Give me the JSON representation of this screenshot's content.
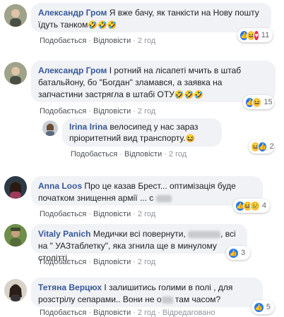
{
  "comments": [
    {
      "author": "Александр Гром",
      "text": "Я вже бачу, як танкісти на Нову пошту їдуть танком",
      "emoji": "🤣🤣🤣",
      "actions": {
        "like": "Подобається",
        "reply": "Відповісти",
        "time": "2 год"
      },
      "reactions": {
        "count": "11"
      }
    },
    {
      "author": "Александр Гром",
      "text": "І ротний на лісапеті мчить в штаб батальйону, бо \"Богдан\" зламався, а заявка на запчастини застрягла в штабі ОТУ",
      "emoji": "🤣🤣🤣",
      "actions": {
        "like": "Подобається",
        "reply": "Відповісти",
        "time": "2 год"
      },
      "reactions": {
        "count": "15"
      }
    },
    {
      "author": "Irina Irina",
      "text": "велосипед у нас зараз пріоритетний вид транспорту.",
      "emoji": "😆",
      "actions": {
        "like": "Подобається",
        "reply": "Відповісти",
        "time": "2 год"
      },
      "reactions": {
        "count": "2"
      }
    },
    {
      "author": "Anna Loos",
      "text": "Про це казав Брест... оптимізація буде початком знищення армії ... с",
      "actions": {
        "like": "Подобається",
        "reply": "Відповісти",
        "time": "2 год"
      },
      "reactions": {
        "count": "4"
      }
    },
    {
      "author": "Vitaly Panich",
      "text_a": "Медички всі повернути,",
      "text_b": ", всі на \" УАЗтаблетку\", яка згнила ще в минулому столітті.",
      "actions": {
        "like": "Подобається",
        "reply": "Відповісти",
        "time": "2 год"
      },
      "reactions": {
        "count": "3"
      }
    },
    {
      "author": "Тетяна Верцюх",
      "text_a": "І залишитись голими в полі , для розстрілу сепарами.. Вони не о",
      "text_b": "там часом?",
      "actions": {
        "like": "Подобається",
        "reply": "Відповісти",
        "time": "2 год",
        "edited": "Відредаговано"
      },
      "reactions": {
        "count": "5"
      }
    }
  ],
  "colors": {
    "author": "#385898",
    "bubble": "#f0f2f5",
    "meta": "#90949c"
  }
}
